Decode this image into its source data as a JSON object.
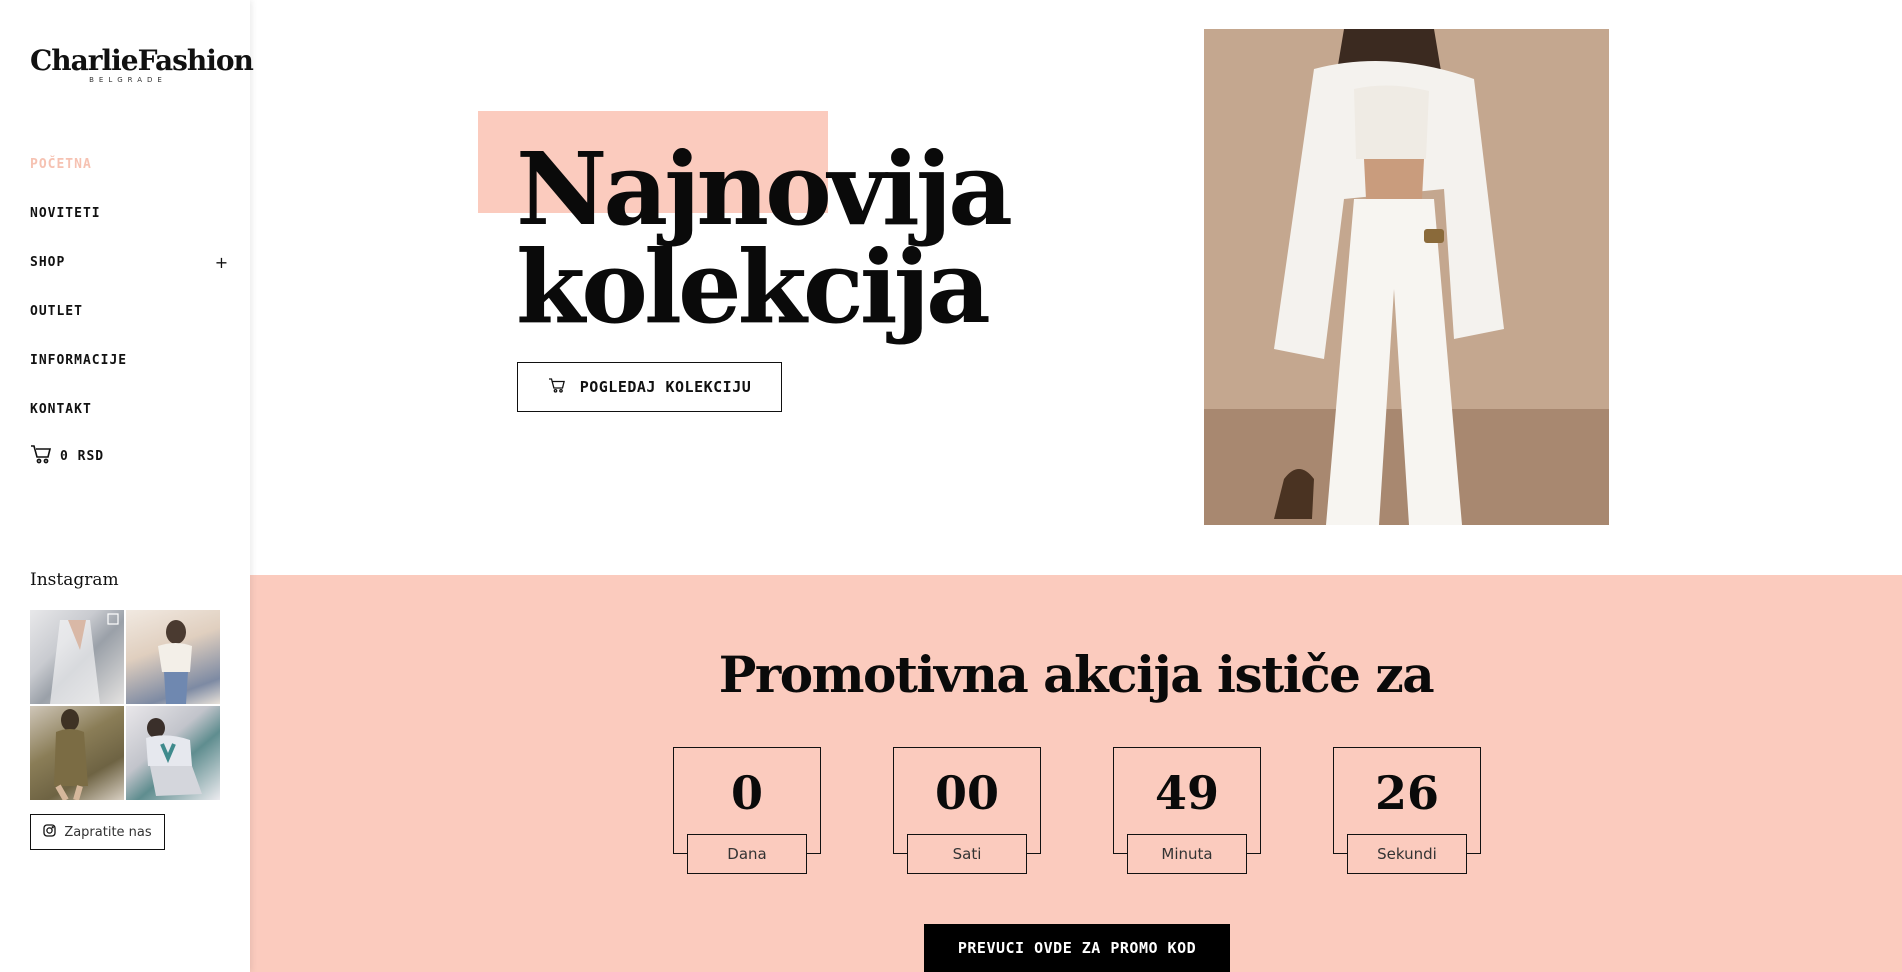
{
  "brand": {
    "name": "CharlieFashion",
    "subtitle": "BELGRADE"
  },
  "nav": {
    "items": [
      {
        "label": "POČETNA",
        "active": true
      },
      {
        "label": "NOVITETI"
      },
      {
        "label": "SHOP",
        "expand": "+"
      },
      {
        "label": "OUTLET"
      },
      {
        "label": "INFORMACIJE"
      },
      {
        "label": "KONTAKT"
      }
    ],
    "cart": {
      "icon": "cart-icon",
      "label": "0 RSD"
    }
  },
  "instagram": {
    "title": "Instagram",
    "photos": [
      "instagram-photo-1",
      "instagram-photo-2",
      "instagram-photo-3",
      "instagram-photo-4"
    ],
    "follow_label": "Zapratite nas"
  },
  "hero": {
    "title_line1": "Najnovija",
    "title_line2": "kolekcija",
    "cta": "POGLEDAJ KOLEKCIJU"
  },
  "promo": {
    "title": "Promotivna akcija ističe za",
    "countdown": [
      {
        "value": "0",
        "label": "Dana"
      },
      {
        "value": "00",
        "label": "Sati"
      },
      {
        "value": "49",
        "label": "Minuta"
      },
      {
        "value": "26",
        "label": "Sekundi"
      }
    ],
    "cta": "PREVUCI OVDE ZA PROMO KOD"
  },
  "colors": {
    "accent": "#fbcbbe",
    "active_nav": "#f6c2b2",
    "text": "#0a0a0a",
    "button_dark": "#000000"
  }
}
